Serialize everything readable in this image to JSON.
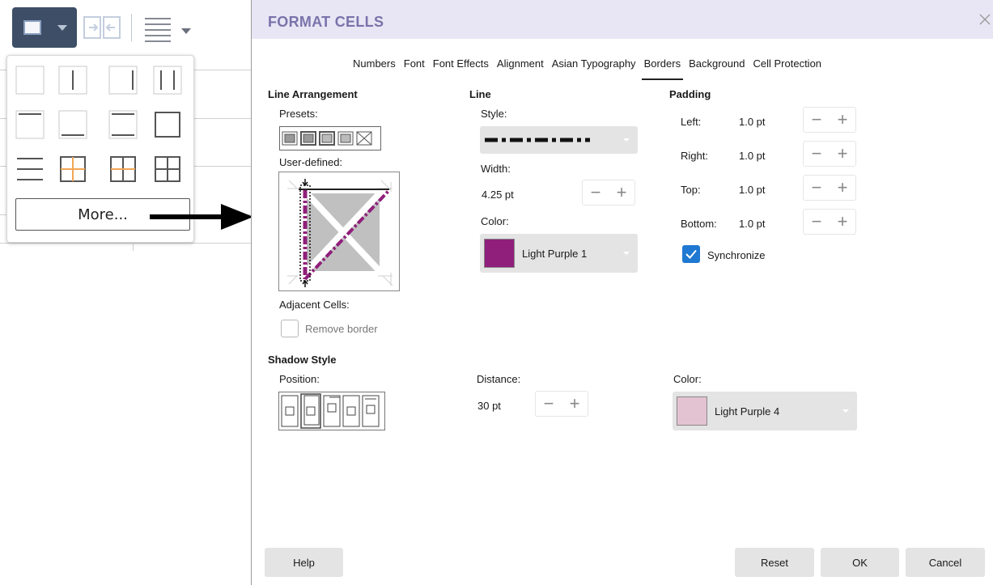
{
  "popup": {
    "more_label": "More..."
  },
  "dialog": {
    "title": "FORMAT CELLS",
    "tabs": [
      {
        "label": "Numbers"
      },
      {
        "label": "Font"
      },
      {
        "label": "Font Effects"
      },
      {
        "label": "Alignment"
      },
      {
        "label": "Asian Typography"
      },
      {
        "label": "Borders",
        "active": true
      },
      {
        "label": "Background"
      },
      {
        "label": "Cell Protection"
      }
    ],
    "active_tab": "Borders"
  },
  "line_arrangement": {
    "heading": "Line Arrangement",
    "presets_label": "Presets:",
    "user_defined_label": "User-defined:",
    "adjacent_cells_label": "Adjacent Cells:",
    "remove_border_label": "Remove border",
    "remove_border_checked": false
  },
  "line": {
    "heading": "Line",
    "style_label": "Style:",
    "width_label": "Width:",
    "width_value": "4.25 pt",
    "color_label": "Color:",
    "color_value": "Light Purple 1",
    "color_hex": "#8f1f7a"
  },
  "padding": {
    "heading": "Padding",
    "left_label": "Left:",
    "left_value": "1.0 pt",
    "right_label": "Right:",
    "right_value": "1.0 pt",
    "top_label": "Top:",
    "top_value": "1.0 pt",
    "bottom_label": "Bottom:",
    "bottom_value": "1.0 pt",
    "synchronize_label": "Synchronize",
    "synchronize_checked": true
  },
  "shadow": {
    "heading": "Shadow Style",
    "position_label": "Position:",
    "distance_label": "Distance:",
    "distance_value": "30 pt",
    "color_label": "Color:",
    "color_value": "Light Purple 4",
    "color_hex": "#e3c3d2"
  },
  "spin": {
    "minus": "−",
    "plus": "+"
  },
  "buttons": {
    "help": "Help",
    "reset": "Reset",
    "ok": "OK",
    "cancel": "Cancel"
  },
  "colors": {
    "title_bar_bg": "#e8e6f4",
    "title_text": "#7a73ab",
    "toolbar_button_active": "#3d4e66",
    "checkbox_blue": "#1f78d1",
    "highlight_orange": "#f2a654"
  }
}
